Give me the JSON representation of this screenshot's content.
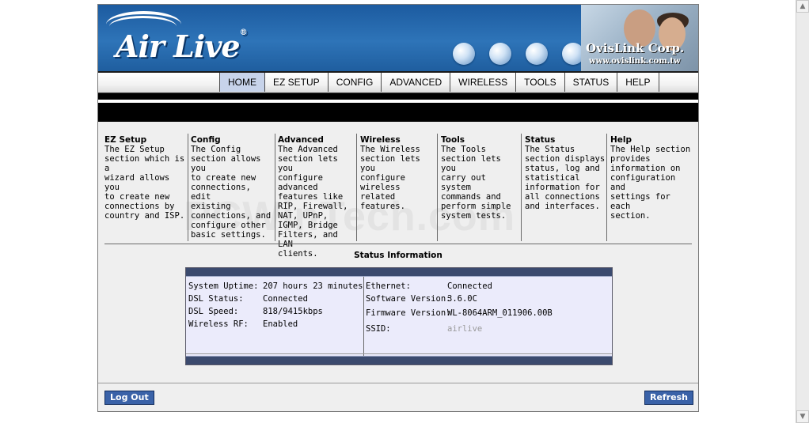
{
  "banner": {
    "logo": "Air Live",
    "logo_mark": "®",
    "brand": "OvisLink Corp.",
    "url": "www.ovislink.com.tw"
  },
  "nav": {
    "tabs": [
      {
        "label": "HOME",
        "active": true
      },
      {
        "label": "EZ SETUP",
        "active": false
      },
      {
        "label": "CONFIG",
        "active": false
      },
      {
        "label": "ADVANCED",
        "active": false
      },
      {
        "label": "WIRELESS",
        "active": false
      },
      {
        "label": "TOOLS",
        "active": false
      },
      {
        "label": "STATUS",
        "active": false
      },
      {
        "label": "HELP",
        "active": false
      }
    ]
  },
  "sections": [
    {
      "title": "EZ Setup",
      "lines": [
        "The EZ Setup",
        "section which is a",
        "wizard allows you",
        "to create new",
        "connections by",
        "country and ISP."
      ]
    },
    {
      "title": "Config",
      "lines": [
        "The Config",
        "section allows you",
        "to create new",
        "connections, edit",
        "existing",
        "connections, and",
        "configure other",
        "basic settings."
      ]
    },
    {
      "title": "Advanced",
      "lines": [
        "The Advanced",
        "section lets you",
        "configure",
        "advanced",
        "features like",
        "RIP, Firewall,",
        "NAT, UPnP,",
        "IGMP, Bridge",
        "Filters, and LAN",
        "clients."
      ]
    },
    {
      "title": "Wireless",
      "lines": [
        "The Wireless",
        "section lets you",
        "configure",
        "wireless related",
        "features."
      ]
    },
    {
      "title": "Tools",
      "lines": [
        "The Tools",
        "section lets you",
        "carry out system",
        "commands and",
        "perform simple",
        "system tests."
      ]
    },
    {
      "title": "Status",
      "lines": [
        "The Status",
        "section displays",
        "status, log and",
        "statistical",
        "information for",
        "all connections",
        "and interfaces."
      ]
    },
    {
      "title": "Help",
      "lines": [
        "The Help section",
        "provides",
        "information on",
        "configuration and",
        "settings for each",
        "section."
      ]
    }
  ],
  "watermark": "PCWinTech.com",
  "status": {
    "title": "Status Information",
    "left": [
      {
        "label": "System Uptime:",
        "value": "207 hours 23 minutes"
      },
      {
        "label": "DSL Status:",
        "value": "Connected"
      },
      {
        "label": "DSL Speed:",
        "value": "818/9415kbps"
      },
      {
        "label": "Wireless RF:",
        "value": "Enabled"
      }
    ],
    "right": [
      {
        "label": "Ethernet:",
        "value": "Connected"
      },
      {
        "label": "Software Version:",
        "value": "3.6.0C"
      },
      {
        "label": "Firmware Version:",
        "value": "WL-8064ARM_011906.00B"
      },
      {
        "label": "SSID:",
        "value": "airlive"
      }
    ]
  },
  "buttons": {
    "logout": "Log Out",
    "refresh": "Refresh"
  },
  "scrollbar": {
    "up": "▲",
    "down": "▼"
  }
}
